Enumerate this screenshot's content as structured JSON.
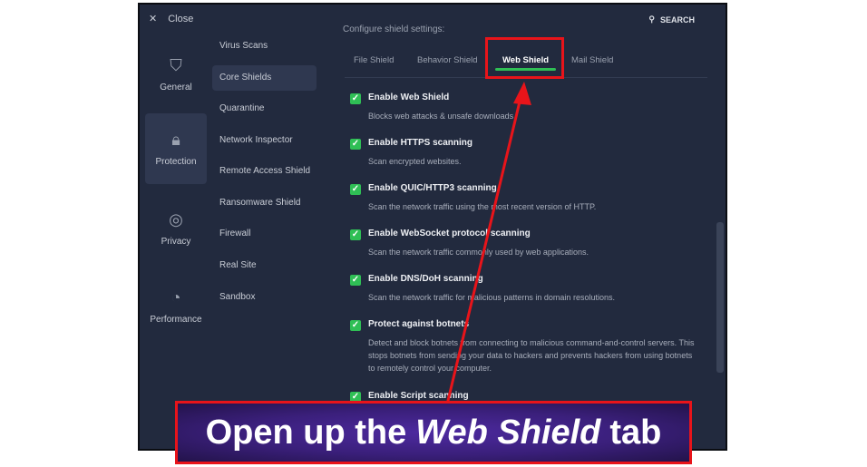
{
  "window": {
    "close_label": "Close",
    "search_label": "SEARCH"
  },
  "categories": [
    {
      "label": "General",
      "icon": "shield-icon"
    },
    {
      "label": "Protection",
      "icon": "lock-icon",
      "selected": true
    },
    {
      "label": "Privacy",
      "icon": "fingerprint-icon"
    },
    {
      "label": "Performance",
      "icon": "gauge-icon"
    }
  ],
  "submenu": [
    "Virus Scans",
    "Core Shields",
    "Quarantine",
    "Network Inspector",
    "Remote Access Shield",
    "Ransomware Shield",
    "Firewall",
    "Real Site",
    "Sandbox"
  ],
  "submenu_selected": "Core Shields",
  "header": "Configure shield settings:",
  "tabs": [
    "File Shield",
    "Behavior Shield",
    "Web Shield",
    "Mail Shield"
  ],
  "active_tab": "Web Shield",
  "options": [
    {
      "title": "Enable Web Shield",
      "desc": "Blocks web attacks & unsafe downloads",
      "checked": true
    },
    {
      "title": "Enable HTTPS scanning",
      "desc": "Scan encrypted websites.",
      "checked": true
    },
    {
      "title": "Enable QUIC/HTTP3 scanning",
      "desc": "Scan the network traffic using the most recent version of HTTP.",
      "checked": true
    },
    {
      "title": "Enable WebSocket protocol scanning",
      "desc": "Scan the network traffic commonly used by web applications.",
      "checked": true
    },
    {
      "title": "Enable DNS/DoH scanning",
      "desc": "Scan the network traffic for malicious patterns in domain resolutions.",
      "checked": true
    },
    {
      "title": "Protect against botnets",
      "desc": "Detect and block botnets from connecting to malicious command-and-control servers. This stops botnets from sending your data to hackers and prevents hackers from using botnets to remotely control your computer.",
      "checked": true
    },
    {
      "title": "Enable Script scanning",
      "desc": "",
      "checked": true
    }
  ],
  "annotation": {
    "pre": "Open up the",
    "em": "Web Shield",
    "post": "tab",
    "color": "#e8141a"
  }
}
